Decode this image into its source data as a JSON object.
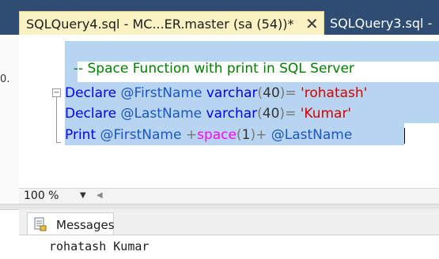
{
  "tabs": [
    {
      "label": "SQLQuery4.sql - MC...ER.master (sa (54))*",
      "active": true
    },
    {
      "label": "SQLQuery3.sql -",
      "active": false
    }
  ],
  "left_fragment": "0.",
  "editor": {
    "comment": "-- Space Function with print in SQL Server",
    "line1": {
      "kw": "Declare",
      "var": "@FirstName",
      "type": "varchar",
      "open": "(",
      "num": "40",
      "close": ")",
      "eq": "=",
      "str": "'rohatash'"
    },
    "line2": {
      "kw": "Declare",
      "var": "@LastName",
      "type": "varchar",
      "open": "(",
      "num": "40",
      "close": ")",
      "eq": "=",
      "str": "'Kumar'"
    },
    "line3": {
      "kw": "Print",
      "var1": "@FirstName",
      "plus1": "+",
      "fn": "space",
      "open": "(",
      "num": "1",
      "close": ")",
      "plus2": "+",
      "var2": "@LastName"
    }
  },
  "status": {
    "zoom": "100 %"
  },
  "results": {
    "tab_label": "Messages",
    "message": "rohatash Kumar"
  },
  "colors": {
    "tabbar": "#2f4d72",
    "active_tab": "#fbf2c4",
    "selection": "#b7d4f0"
  }
}
